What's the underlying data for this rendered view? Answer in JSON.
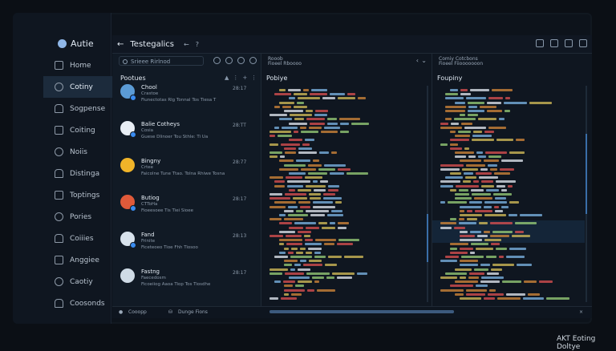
{
  "app": {
    "name": "Autie"
  },
  "window": {
    "title": "Testegalics"
  },
  "sidebar": {
    "items": [
      {
        "label": "Home",
        "icon": "home-icon",
        "active": false
      },
      {
        "label": "Cotiny",
        "icon": "cube-icon",
        "active": true
      },
      {
        "label": "Sogpense",
        "icon": "list-icon",
        "active": false
      },
      {
        "label": "Coiting",
        "icon": "gear-icon",
        "active": false
      },
      {
        "label": "Noiis",
        "icon": "bell-icon",
        "active": false
      },
      {
        "label": "Distinga",
        "icon": "folder-icon",
        "active": false
      },
      {
        "label": "Toptings",
        "icon": "chart-icon",
        "active": false
      },
      {
        "label": "Pories",
        "icon": "grid-icon",
        "active": false
      },
      {
        "label": "Coiiies",
        "icon": "user-icon",
        "active": false
      },
      {
        "label": "Anggiee",
        "icon": "shield-icon",
        "active": false
      },
      {
        "label": "Caotiy",
        "icon": "link-icon",
        "active": false
      },
      {
        "label": "Coosonds",
        "icon": "database-icon",
        "active": false
      }
    ]
  },
  "list_panel": {
    "search_placeholder": "Srieee Rirlnod",
    "heading": "Pootues",
    "items": [
      {
        "name": "Chool",
        "line1": "Crastoe",
        "line2": "Fiunectotas Rlg Tonnal Tos Tiesa T",
        "time": "28:17",
        "avatar_color": "#5b9bd5",
        "badge": true
      },
      {
        "name": "Balie Cotheys",
        "line1": "Cosia",
        "line2": "Guese Dlinoer Tou Sthle: Ti Ua",
        "time": "28:TT",
        "avatar_color": "#e8eef5",
        "badge": true
      },
      {
        "name": "Bingny",
        "line1": "Crtee",
        "line2": "Faicolne Tune Ttao. Tolna Rhiwe Tosna",
        "time": "28:77",
        "avatar_color": "#f0b429",
        "badge": false
      },
      {
        "name": "Butiog",
        "line1": "CTToHa",
        "line2": "Fioeesoee Tis Tiei Sioee",
        "time": "28:17",
        "avatar_color": "#e05a3a",
        "badge": true
      },
      {
        "name": "Fand",
        "line1": "Frinite",
        "line2": "Ficeteoeo Tioe Fhh Tiosoo",
        "time": "28:13",
        "avatar_color": "#d8e2ec",
        "badge": true
      },
      {
        "name": "Fastng",
        "line1": "Faecedosm",
        "line2": "Ficoeiiog Aaoa Tiop Tos Tiosdhe",
        "time": "28:17",
        "avatar_color": "#cfdbe6",
        "badge": false
      }
    ]
  },
  "code_panel": {
    "head1": "Rooob",
    "head2": "Fioeel Rboooo",
    "label": "Pobiye"
  },
  "code_panel2": {
    "head1": "Comiy Cotcbons",
    "head2": "Fioeel Fiiooooooon",
    "label": "Foupiny"
  },
  "statusbar": {
    "left": "Cooopp",
    "right": "Dunge Fions"
  },
  "watermark": "AKT Eoting Doltye"
}
